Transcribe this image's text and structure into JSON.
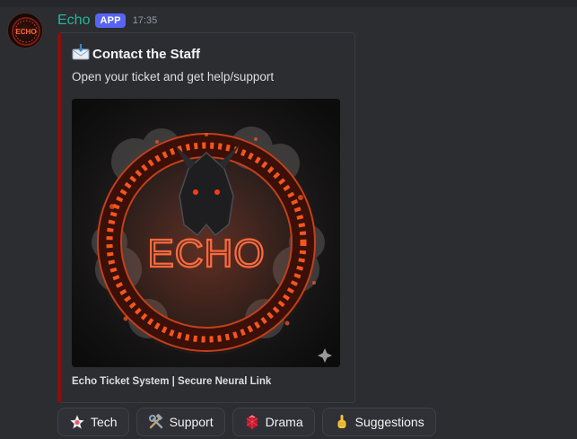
{
  "message": {
    "author": "Echo",
    "badge": "APP",
    "timestamp": "17:35",
    "avatar_icon": "echo-dragon-avatar"
  },
  "embed": {
    "accent_color": "#8b0e0e",
    "title_icon": "incoming-envelope-icon",
    "title": "Contact the Staff",
    "description": "Open your ticket and get help/support",
    "image_alt": "Echo dragon rune circle artwork",
    "image_logo_text": "ECHO",
    "footer": "Echo Ticket System | Secure Neural Link"
  },
  "buttons": [
    {
      "icon": "glowing-star-icon",
      "label": "Tech"
    },
    {
      "icon": "hammer-and-wrench-icon",
      "label": "Support"
    },
    {
      "icon": "red-gem-icon",
      "label": "Drama"
    },
    {
      "icon": "pointing-finger-icon",
      "label": "Suggestions"
    }
  ]
}
